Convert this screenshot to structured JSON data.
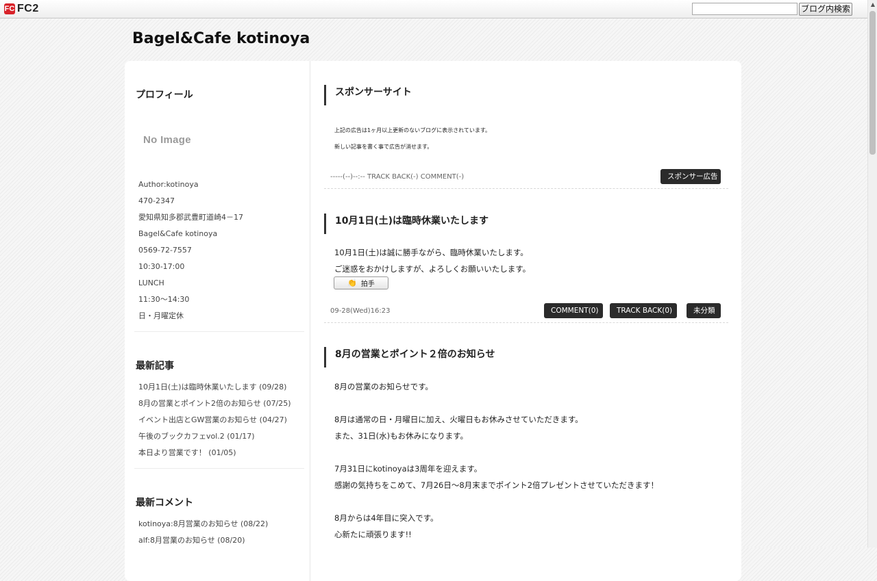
{
  "fc2bar": {
    "logo_mark": "FC",
    "logo_text": "FC2",
    "search_placeholder": "",
    "search_button": "ブログ内検索"
  },
  "blog": {
    "title": "Bagel&Cafe kotinoya"
  },
  "sidebar": {
    "profile": {
      "heading": "プロフィール",
      "no_image": "No Image",
      "lines": [
        "Author:kotinoya",
        "470-2347",
        "愛知県知多郡武豊町道崎4－17",
        "Bagel&Cafe  kotinoya",
        "0569-72-7557",
        "10:30‐17:00",
        "LUNCH",
        "11:30～14:30",
        "日・月曜定休"
      ]
    },
    "recent_posts": {
      "heading": "最新記事",
      "items": [
        "10月1日(土)は臨時休業いたします (09/28)",
        "8月の営業とポイント2倍のお知らせ (07/25)",
        "イベント出店とGW営業のお知らせ (04/27)",
        "午後のブックカフェvol.2 (01/17)",
        "本日より営業です！ (01/05)"
      ]
    },
    "recent_comments": {
      "heading": "最新コメント",
      "items": [
        "kotinoya:8月営業のお知らせ (08/22)",
        "alf:8月営業のお知らせ (08/20)"
      ]
    }
  },
  "entries": [
    {
      "title": "スポンサーサイト",
      "body": [
        "上記の広告は1ヶ月以上更新のないブログに表示されています。",
        "新しい記事を書く事で広告が消せます。"
      ],
      "meta": "-----(--)--:-- TRACK BACK(-) COMMENT(-)",
      "buttons": [
        "スポンサー広告"
      ]
    },
    {
      "title": "10月1日(土)は臨時休業いたします",
      "body": [
        "10月1日(土)は誠に勝手ながら、臨時休業いたします。",
        "ご迷惑をおかけしますが、よろしくお願いいたします。"
      ],
      "clap_label": "拍手",
      "meta": "09-28(Wed)16:23",
      "buttons": [
        "COMMENT(0)",
        "TRACK BACK(0)",
        "未分類"
      ]
    },
    {
      "title": "8月の営業とポイント２倍のお知らせ",
      "body": [
        "8月の営業のお知らせです。",
        "",
        "8月は通常の日・月曜日に加え、火曜日もお休みさせていただきます。",
        "また、31日(水)もお休みになります。",
        "",
        "7月31日にkotinoyaは3周年を迎えます。",
        "感謝の気持ちをこめて、7月26日～8月末までポイント2倍プレゼントさせていただきます！",
        "",
        "8月からは4年目に突入です。",
        "心新たに頑張ります!!"
      ]
    }
  ]
}
